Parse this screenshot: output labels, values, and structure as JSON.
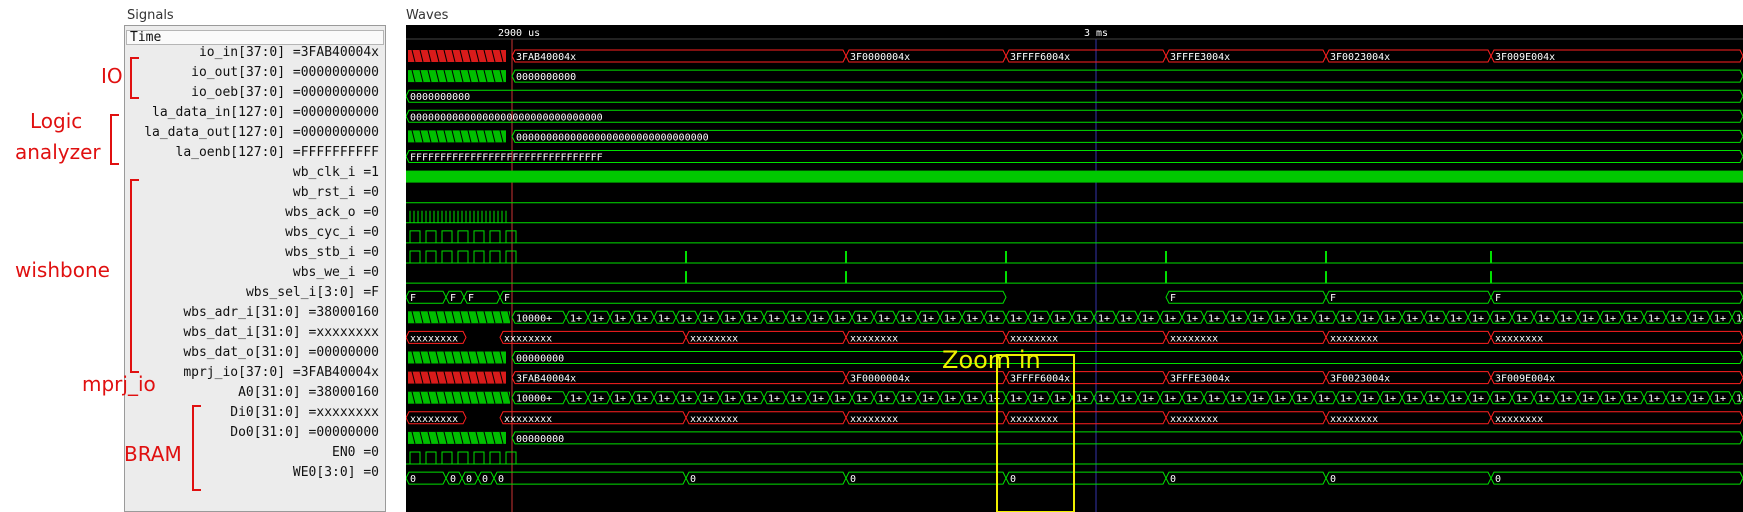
{
  "panels": {
    "signals_title": "Signals",
    "waves_title": "Waves",
    "time_label": "Time"
  },
  "timeline": {
    "marker1": "2900 us",
    "marker2": "3 ms"
  },
  "signals": [
    {
      "label": "io_in[37:0] =3FAB40004x"
    },
    {
      "label": "io_out[37:0] =0000000000"
    },
    {
      "label": "io_oeb[37:0] =0000000000"
    },
    {
      "label": "la_data_in[127:0] =0000000000"
    },
    {
      "label": "la_data_out[127:0] =0000000000"
    },
    {
      "label": "la_oenb[127:0] =FFFFFFFFFF"
    },
    {
      "label": "wb_clk_i =1"
    },
    {
      "label": "wb_rst_i =0"
    },
    {
      "label": "wbs_ack_o =0"
    },
    {
      "label": "wbs_cyc_i =0"
    },
    {
      "label": "wbs_stb_i =0"
    },
    {
      "label": "wbs_we_i =0"
    },
    {
      "label": "wbs_sel_i[3:0] =F"
    },
    {
      "label": "wbs_adr_i[31:0] =38000160"
    },
    {
      "label": "wbs_dat_i[31:0] =xxxxxxxx"
    },
    {
      "label": "wbs_dat_o[31:0] =00000000"
    },
    {
      "label": "mprj_io[37:0] =3FAB40004x"
    },
    {
      "label": "A0[31:0] =38000160"
    },
    {
      "label": "Di0[31:0] =xxxxxxxx"
    },
    {
      "label": "Do0[31:0] =00000000"
    },
    {
      "label": "EN0 =0"
    },
    {
      "label": "WE0[3:0] =0"
    }
  ],
  "wave_values": {
    "io_in": [
      "3FAB40004x",
      "3F0000004x",
      "3FFFF6004x",
      "3FFFE3004x",
      "3F0023004x",
      "3F009E004x"
    ],
    "io_out": "0000000000",
    "io_oeb": "0000000000",
    "la_data_in": "00000000000000000000000000000000",
    "la_data_out": "00000000000000000000000000000000",
    "la_oenb": "FFFFFFFFFFFFFFFFFFFFFFFFFFFFFFFF",
    "sel": "F",
    "adr_first": "10000+",
    "adr_seg": "1+",
    "dat_x": "xxxxxxxx",
    "dat_o": "00000000",
    "we0": "0"
  },
  "annotations": {
    "io": "IO",
    "logic1": "Logic",
    "logic2": "analyzer",
    "wishbone": "wishbone",
    "mprj": "mprj_io",
    "bram": "BRAM",
    "zoom": "Zoom in"
  },
  "colors": {
    "red": "#ff2020",
    "green": "#00e000",
    "bright_green": "#00c800",
    "zoom_box": "#f0f000",
    "annotation": "#e01010"
  }
}
